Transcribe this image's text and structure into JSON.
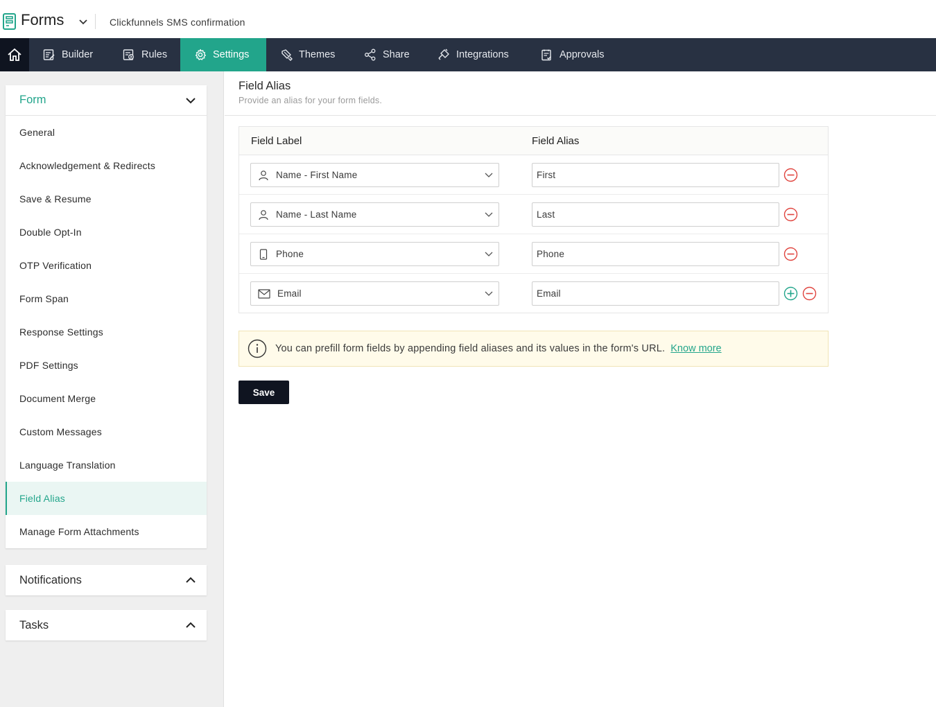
{
  "header": {
    "app_name": "Forms",
    "form_title": "Clickfunnels SMS confirmation"
  },
  "nav": {
    "items": [
      {
        "label": "Builder",
        "icon": "builder-icon"
      },
      {
        "label": "Rules",
        "icon": "rules-icon"
      },
      {
        "label": "Settings",
        "icon": "gear-icon",
        "active": true
      },
      {
        "label": "Themes",
        "icon": "paintbrush-icon"
      },
      {
        "label": "Share",
        "icon": "share-icon"
      },
      {
        "label": "Integrations",
        "icon": "plug-icon"
      },
      {
        "label": "Approvals",
        "icon": "approvals-icon"
      }
    ]
  },
  "sidebar": {
    "form_section_title": "Form",
    "items": [
      "General",
      "Acknowledgement & Redirects",
      "Save & Resume",
      "Double Opt-In",
      "OTP Verification",
      "Form Span",
      "Response Settings",
      "PDF Settings",
      "Document Merge",
      "Custom Messages",
      "Language Translation",
      "Field Alias",
      "Manage Form Attachments"
    ],
    "active_item": "Field Alias",
    "notifications_title": "Notifications",
    "tasks_title": "Tasks"
  },
  "main": {
    "title": "Field Alias",
    "subtitle": "Provide an alias for your form fields.",
    "col_field_label": "Field Label",
    "col_field_alias": "Field Alias",
    "rows": [
      {
        "field": "Name - First Name",
        "icon": "user-icon",
        "alias": "First"
      },
      {
        "field": "Name - Last Name",
        "icon": "user-icon",
        "alias": "Last"
      },
      {
        "field": "Phone",
        "icon": "phone-icon",
        "alias": "Phone"
      },
      {
        "field": "Email",
        "icon": "envelope-icon",
        "alias": "Email"
      }
    ],
    "info_text": "You can prefill form fields by appending field aliases and its values in the form's URL.",
    "info_link": "Know more",
    "save_label": "Save"
  },
  "colors": {
    "accent": "#22a58b",
    "nav_bg": "#283142",
    "danger": "#e0443e"
  }
}
